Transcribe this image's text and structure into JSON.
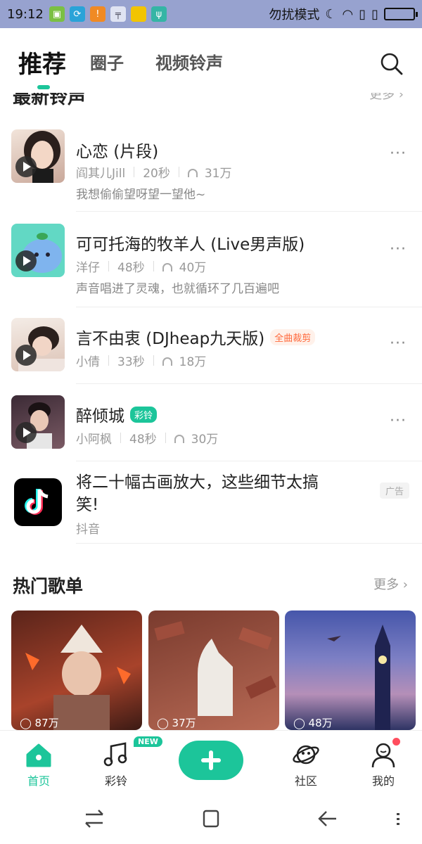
{
  "status_bar": {
    "time": "19:12",
    "dnd_label": "勿扰模式"
  },
  "header": {
    "tabs": [
      "推荐",
      "圈子",
      "视频铃声"
    ],
    "active_tab": 0
  },
  "partial_section": {
    "title": "最新铃声",
    "more": "更多 ›"
  },
  "songs": [
    {
      "title": "心恋 (片段)",
      "artist": "阎其儿Jill",
      "duration": "20秒",
      "plays": "31万",
      "desc": "我想偷偷望呀望一望他~",
      "badge": "",
      "thumb_color": "#d9c7bd"
    },
    {
      "title": "可可托海的牧羊人 (Live男声版)",
      "artist": "洋仔",
      "duration": "48秒",
      "plays": "40万",
      "desc": "声音唱进了灵魂，也就循环了几百遍吧",
      "badge": "",
      "thumb_color": "#5fd9c6"
    },
    {
      "title": "言不由衷 (DJheap九天版)",
      "artist": "小倩",
      "duration": "33秒",
      "plays": "18万",
      "desc": "",
      "badge": "全曲裁剪",
      "thumb_color": "#e8d8d0"
    },
    {
      "title": "醉倾城",
      "artist": "小阿枫",
      "duration": "48秒",
      "plays": "30万",
      "desc": "",
      "badge": "彩铃",
      "thumb_color": "#5a3c4a"
    }
  ],
  "ad": {
    "title_line1": "将二十幅古画放大，这些细节太搞",
    "title_line2": "笑!",
    "source": "抖音",
    "tag": "广告"
  },
  "hot_playlists": {
    "title": "热门歌单",
    "more": "更多 ›",
    "items": [
      {
        "plays": "87万",
        "colors": [
          "#6b2a1f",
          "#b3472d"
        ]
      },
      {
        "plays": "37万",
        "colors": [
          "#7a3b2e",
          "#c07966"
        ]
      },
      {
        "plays": "48万",
        "colors": [
          "#4a57a8",
          "#c59ab8"
        ]
      }
    ]
  },
  "bottom_nav": {
    "items": [
      "首页",
      "彩铃",
      "",
      "社区",
      "我的"
    ],
    "new_badge": "NEW",
    "accent": "#1cc59a"
  }
}
